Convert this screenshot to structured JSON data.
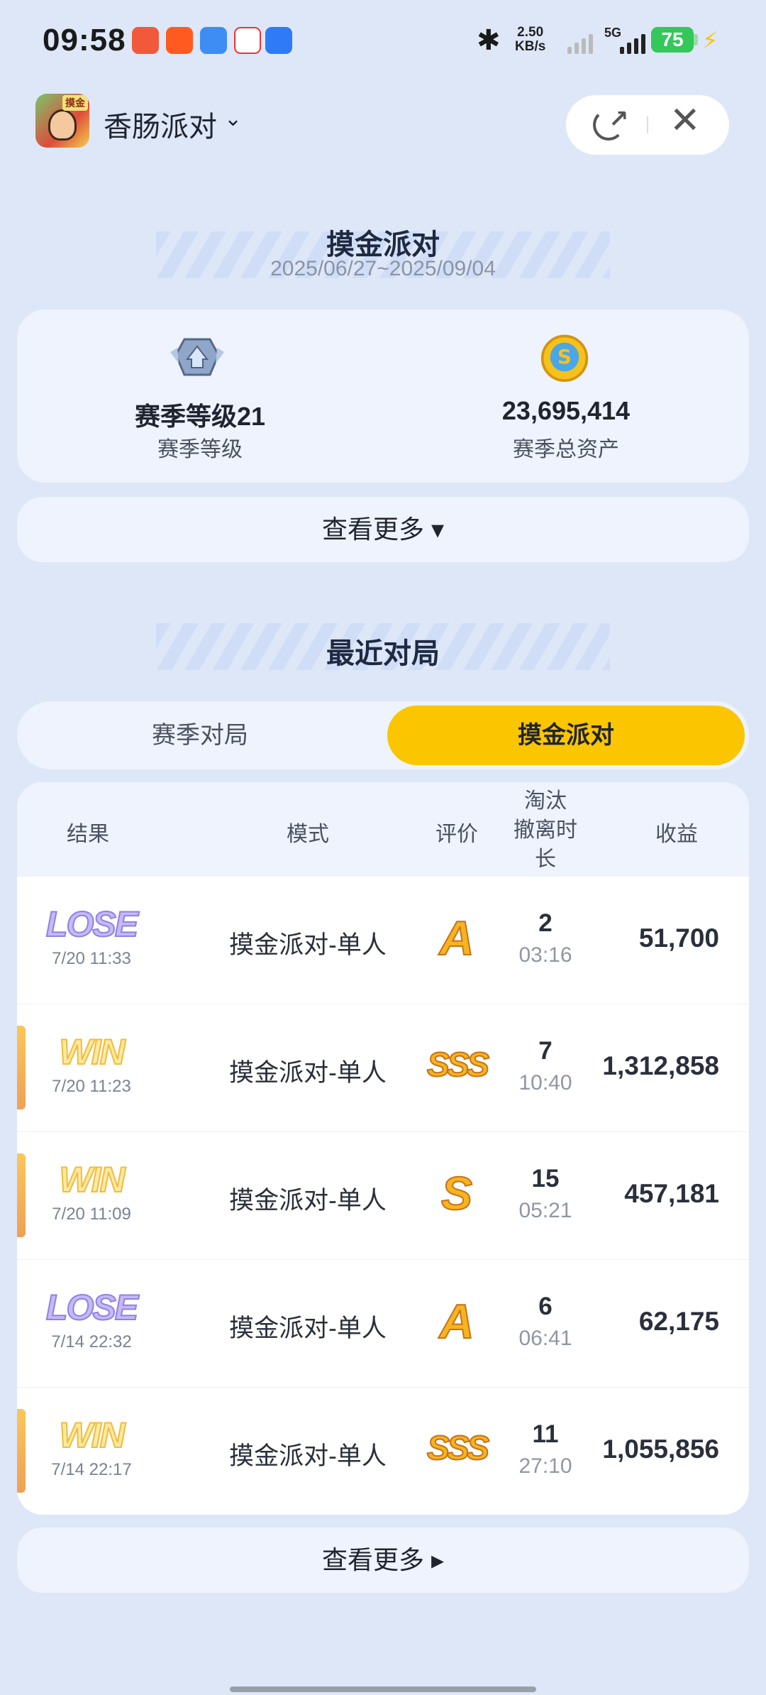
{
  "status_bar": {
    "time": "09:58",
    "net_speed_value": "2.50",
    "net_speed_unit": "KB/s",
    "network": "5G",
    "battery": "75"
  },
  "header": {
    "app_name": "香肠派对",
    "app_icon_tag": "摸金"
  },
  "season": {
    "title": "摸金派对",
    "date_range": "2025/06/27~2025/09/04",
    "level_value": "赛季等级21",
    "level_label": "赛季等级",
    "assets_value": "23,695,414",
    "assets_label": "赛季总资产",
    "more_label": "查看更多 ▾"
  },
  "recent": {
    "title": "最近对局",
    "tabs": [
      {
        "label": "赛季对局",
        "active": false
      },
      {
        "label": "摸金派对",
        "active": true
      }
    ],
    "columns": {
      "result": "结果",
      "mode": "模式",
      "rating": "评价",
      "rank_duration": [
        "淘汰",
        "撤离时",
        "长"
      ],
      "earnings": "收益"
    },
    "rows": [
      {
        "result": "LOSE",
        "time": "7/20 11:33",
        "mode": "摸金派对-单人",
        "grade": "A",
        "rank": "2",
        "duration": "03:16",
        "earnings": "51,700"
      },
      {
        "result": "WIN",
        "time": "7/20 11:23",
        "mode": "摸金派对-单人",
        "grade": "SSS",
        "rank": "7",
        "duration": "10:40",
        "earnings": "1,312,858"
      },
      {
        "result": "WIN",
        "time": "7/20 11:09",
        "mode": "摸金派对-单人",
        "grade": "S",
        "rank": "15",
        "duration": "05:21",
        "earnings": "457,181"
      },
      {
        "result": "LOSE",
        "time": "7/14 22:32",
        "mode": "摸金派对-单人",
        "grade": "A",
        "rank": "6",
        "duration": "06:41",
        "earnings": "62,175"
      },
      {
        "result": "WIN",
        "time": "7/14 22:17",
        "mode": "摸金派对-单人",
        "grade": "SSS",
        "rank": "11",
        "duration": "27:10",
        "earnings": "1,055,856"
      }
    ],
    "more_label": "查看更多 ▸"
  },
  "colors": {
    "accent": "#fbc500",
    "background": "#dde7f8",
    "card": "#eef3fd"
  }
}
